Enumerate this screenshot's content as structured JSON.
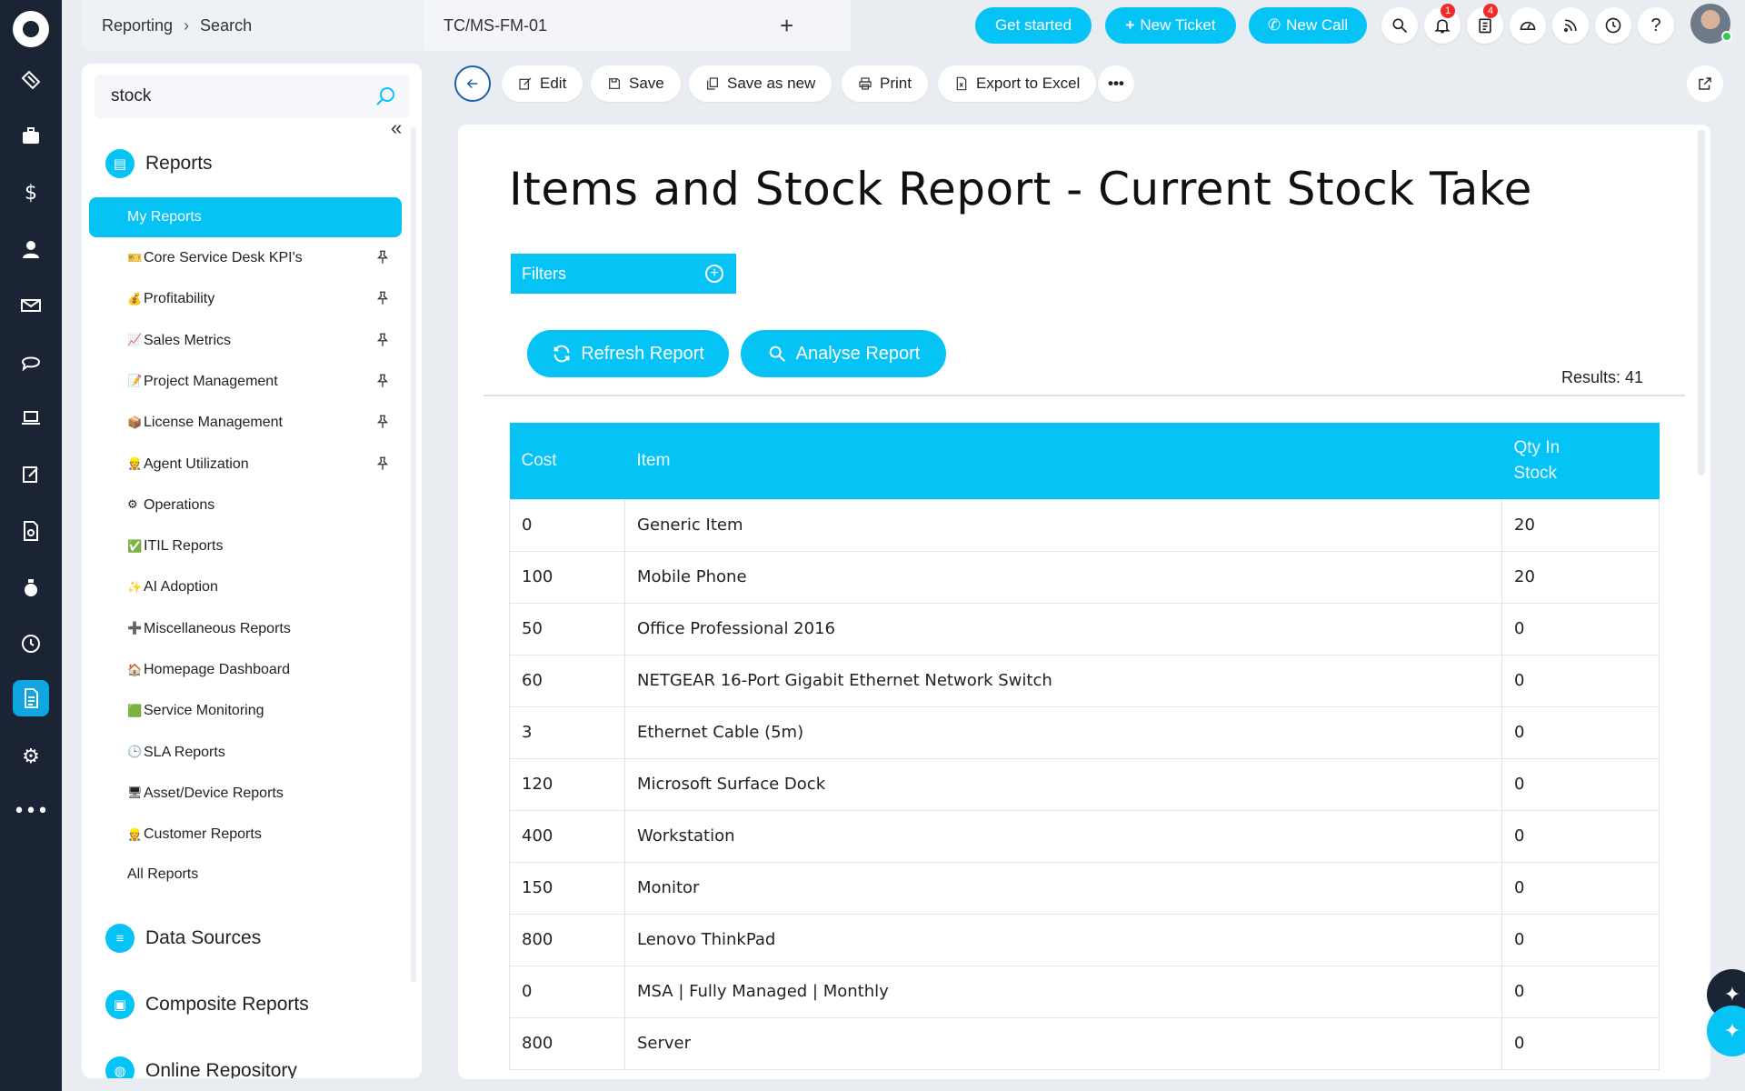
{
  "breadcrumb": {
    "first": "Reporting",
    "second": "Search"
  },
  "tab": {
    "title": "TC/MS-FM-01",
    "add_label": "+"
  },
  "top_actions": {
    "get_started": "Get started",
    "new_ticket": "New Ticket",
    "new_call": "New Call"
  },
  "notifications": {
    "bell_count": "1",
    "clipboard_count": "4"
  },
  "sidebar": {
    "search_value": "stock",
    "collapse_label": "«",
    "reports_title": "Reports",
    "my_reports": "My Reports",
    "items": [
      {
        "emoji": "🎫",
        "label": "Core Service Desk KPI's",
        "pinned": true
      },
      {
        "emoji": "💰",
        "label": "Profitability",
        "pinned": true
      },
      {
        "emoji": "📈",
        "label": "Sales Metrics",
        "pinned": true
      },
      {
        "emoji": "📝",
        "label": "Project Management",
        "pinned": true
      },
      {
        "emoji": "📦",
        "label": "License Management",
        "pinned": true
      },
      {
        "emoji": "👷",
        "label": "Agent Utilization",
        "pinned": true
      },
      {
        "emoji": "⚙",
        "label": "Operations",
        "pinned": false
      },
      {
        "emoji": "✅",
        "label": "ITIL Reports",
        "pinned": false
      },
      {
        "emoji": "✨",
        "label": "AI Adoption",
        "pinned": false
      },
      {
        "emoji": "➕",
        "label": "Miscellaneous Reports",
        "pinned": false
      },
      {
        "emoji": "🏠",
        "label": "Homepage Dashboard",
        "pinned": false
      },
      {
        "emoji": "🟩",
        "label": "Service Monitoring",
        "pinned": false
      },
      {
        "emoji": "🕒",
        "label": "SLA Reports",
        "pinned": false
      },
      {
        "emoji": "🖥",
        "label": "Asset/Device Reports",
        "pinned": false
      },
      {
        "emoji": "👷",
        "label": "Customer Reports",
        "pinned": false
      }
    ],
    "all_reports": "All Reports",
    "data_sources": "Data Sources",
    "composite_reports": "Composite Reports",
    "online_repository": "Online Repository"
  },
  "toolbar": {
    "edit": "Edit",
    "save": "Save",
    "save_as_new": "Save as new",
    "print": "Print",
    "export": "Export to Excel",
    "more": "•••"
  },
  "report": {
    "title": "Items and Stock Report - Current Stock Take",
    "filters_label": "Filters",
    "refresh_label": "Refresh Report",
    "analyse_label": "Analyse Report",
    "results_label": "Results: 41",
    "columns": [
      "Cost",
      "Item",
      "Qty In Stock"
    ],
    "rows": [
      [
        "0",
        "Generic Item",
        "20"
      ],
      [
        "100",
        "Mobile Phone",
        "20"
      ],
      [
        "50",
        "Office Professional 2016",
        "0"
      ],
      [
        "60",
        "NETGEAR 16-Port Gigabit Ethernet Network Switch",
        "0"
      ],
      [
        "3",
        "Ethernet Cable (5m)",
        "0"
      ],
      [
        "120",
        "Microsoft Surface Dock",
        "0"
      ],
      [
        "400",
        "Workstation",
        "0"
      ],
      [
        "150",
        "Monitor",
        "0"
      ],
      [
        "800",
        "Lenovo ThinkPad",
        "0"
      ],
      [
        "0",
        "MSA | Fully Managed | Monthly",
        "0"
      ],
      [
        "800",
        "Server",
        "0"
      ]
    ]
  },
  "colors": {
    "accent": "#06c3f5",
    "rail": "#1b2435",
    "background": "#e9edf2"
  }
}
